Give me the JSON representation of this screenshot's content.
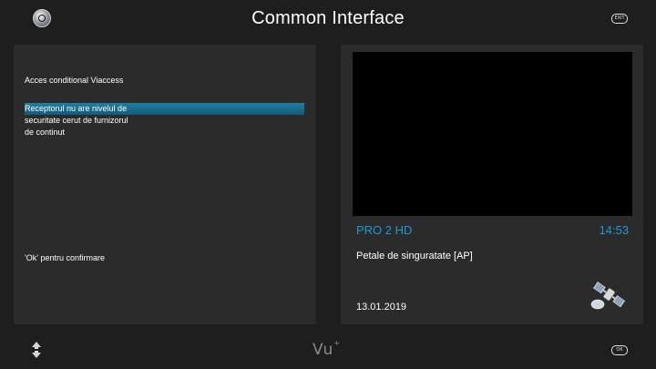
{
  "header": {
    "title": "Common Interface",
    "exit_key": "EXIT"
  },
  "ci_panel": {
    "heading": "Acces conditional Viaccess",
    "message_lines": [
      "Receptorul nu are nivelul de",
      "securitate cerut de furnizorul",
      "de continut"
    ],
    "confirm_text": "'Ok' pentru confirmare"
  },
  "info_panel": {
    "channel_name": "PRO 2 HD",
    "clock": "14:53",
    "event_title": "Petale de singuratate [AP]",
    "event_date": "13.01.2019"
  },
  "footer": {
    "brand": "Vu",
    "brand_mark": "+",
    "ok_key": "OK"
  },
  "colors": {
    "background": "#1e1e1e",
    "panel": "#2b2b2b",
    "accent": "#1d9ad6",
    "selection": "#1e7fa3"
  },
  "icons": {
    "logo": "vu-logo-button-icon",
    "nav": "up-down-arrows-icon",
    "service": "satellite-dish-icon"
  }
}
